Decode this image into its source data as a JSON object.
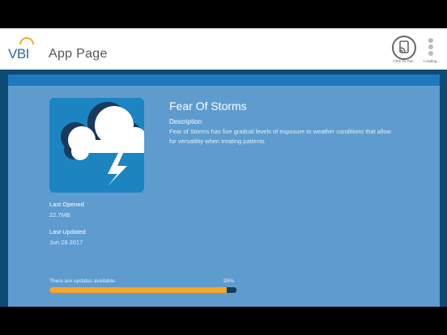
{
  "header": {
    "logo_text": "VBI",
    "page_title": "App Page",
    "cast_label": "Click To Run",
    "loading_label": "Loading..."
  },
  "app": {
    "title": "Fear Of Storms",
    "description_label": "Description",
    "description": "Fear of Storms has five gradual levels of exposure to weather conditions that allow for versatility when treating patients.",
    "icon": "storm-cloud-lightning-icon"
  },
  "meta": {
    "last_opened_label": "Last Opened",
    "size": "22.7MB",
    "last_updated_label": "Last Updated",
    "updated_date": "Jun 28 2017"
  },
  "update": {
    "text": "There are updates available.",
    "percent_label": "95%",
    "progress": 0.95
  },
  "colors": {
    "panel": "#5e9ccf",
    "accent": "#1f78bd",
    "progress": "#f7a62a"
  }
}
